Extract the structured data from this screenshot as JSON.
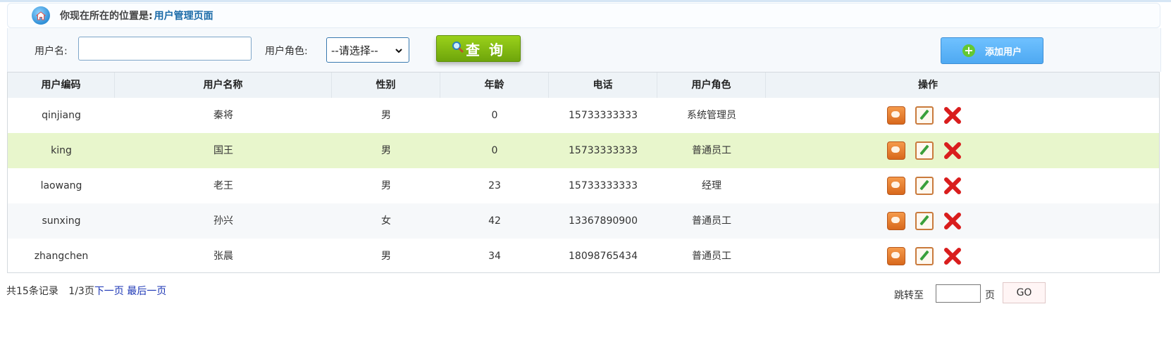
{
  "breadcrumb": {
    "prefix": "你现在所在的位置是:",
    "location": "用户管理页面"
  },
  "search": {
    "username_label": "用户名:",
    "username_value": "",
    "role_label": "用户角色:",
    "role_selected": "--请选择--",
    "query_button": "查 询",
    "add_button": "添加用户"
  },
  "table": {
    "headers": [
      "用户编码",
      "用户名称",
      "性别",
      "年龄",
      "电话",
      "用户角色",
      "操作"
    ],
    "rows": [
      {
        "code": "qinjiang",
        "name": "秦将",
        "gender": "男",
        "age": "0",
        "phone": "15733333333",
        "role": "系统管理员"
      },
      {
        "code": "king",
        "name": "国王",
        "gender": "男",
        "age": "0",
        "phone": "15733333333",
        "role": "普通员工"
      },
      {
        "code": "laowang",
        "name": "老王",
        "gender": "男",
        "age": "23",
        "phone": "15733333333",
        "role": "经理"
      },
      {
        "code": "sunxing",
        "name": "孙兴",
        "gender": "女",
        "age": "42",
        "phone": "13367890900",
        "role": "普通员工"
      },
      {
        "code": "zhangchen",
        "name": "张晨",
        "gender": "男",
        "age": "34",
        "phone": "18098765434",
        "role": "普通员工"
      }
    ]
  },
  "pagination": {
    "total": "共15条记录",
    "page": "1/3页",
    "next": "下一页",
    "last": "最后一页",
    "jump_label": "跳转至",
    "jump_value": "",
    "page_unit": "页",
    "go_button": "GO"
  },
  "colors": {
    "highlight_row": "#e8f6cc",
    "query_button": "#8cc415",
    "add_button": "#5bb4f8",
    "link": "#1b35b5"
  },
  "icons": {
    "home": "home-icon",
    "search": "magnifier-icon",
    "add": "plus-circle-icon",
    "view": "speech-bubble-icon",
    "edit": "pencil-icon",
    "delete": "red-x-icon"
  }
}
